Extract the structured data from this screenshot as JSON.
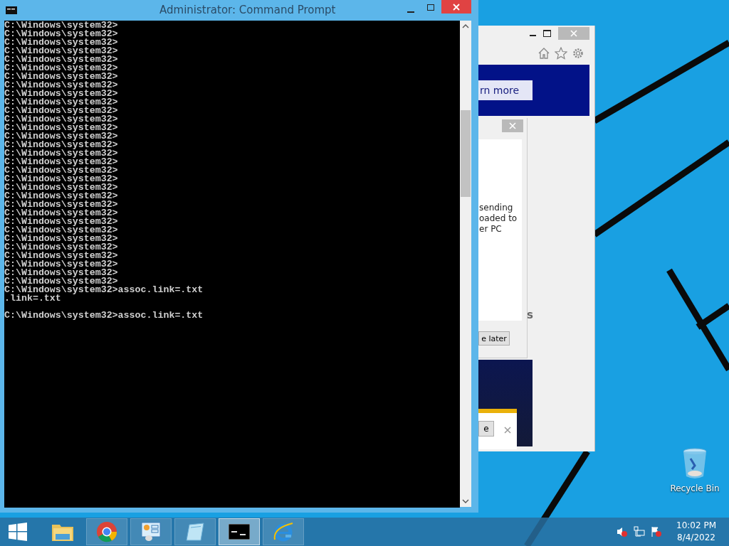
{
  "console_window": {
    "title": "Administrator: Command Prompt",
    "lines": [
      "C:\\Windows\\system32>",
      "C:\\Windows\\system32>",
      "C:\\Windows\\system32>",
      "C:\\Windows\\system32>",
      "C:\\Windows\\system32>",
      "C:\\Windows\\system32>",
      "C:\\Windows\\system32>",
      "C:\\Windows\\system32>",
      "C:\\Windows\\system32>",
      "C:\\Windows\\system32>",
      "C:\\Windows\\system32>",
      "C:\\Windows\\system32>",
      "C:\\Windows\\system32>",
      "C:\\Windows\\system32>",
      "C:\\Windows\\system32>",
      "C:\\Windows\\system32>",
      "C:\\Windows\\system32>",
      "C:\\Windows\\system32>",
      "C:\\Windows\\system32>",
      "C:\\Windows\\system32>",
      "C:\\Windows\\system32>",
      "C:\\Windows\\system32>",
      "C:\\Windows\\system32>",
      "C:\\Windows\\system32>",
      "C:\\Windows\\system32>",
      "C:\\Windows\\system32>",
      "C:\\Windows\\system32>",
      "C:\\Windows\\system32>",
      "C:\\Windows\\system32>",
      "C:\\Windows\\system32>",
      "C:\\Windows\\system32>",
      "C:\\Windows\\system32>assoc.link=.txt",
      ".link=.txt"
    ],
    "current_line": "C:\\Windows\\system32>assoc.link=.txt"
  },
  "browser_window": {
    "banner_button": "rn more",
    "dialog": {
      "lines": [
        "sending",
        "oaded to",
        "er PC"
      ],
      "button": "e later"
    },
    "heading_fragment": "s",
    "notification": {
      "button": "e"
    }
  },
  "desktop_icons": [
    {
      "label": "Recycle Bin"
    }
  ],
  "taskbar": {
    "items": [
      {
        "kind": "explorer",
        "selected": false
      },
      {
        "kind": "chrome",
        "selected": false
      },
      {
        "kind": "control-panel",
        "selected": false
      },
      {
        "kind": "notepad",
        "selected": false
      },
      {
        "kind": "console",
        "selected": true
      },
      {
        "kind": "ie",
        "selected": false
      }
    ],
    "time": "10:02 PM",
    "date": "8/4/2022"
  }
}
